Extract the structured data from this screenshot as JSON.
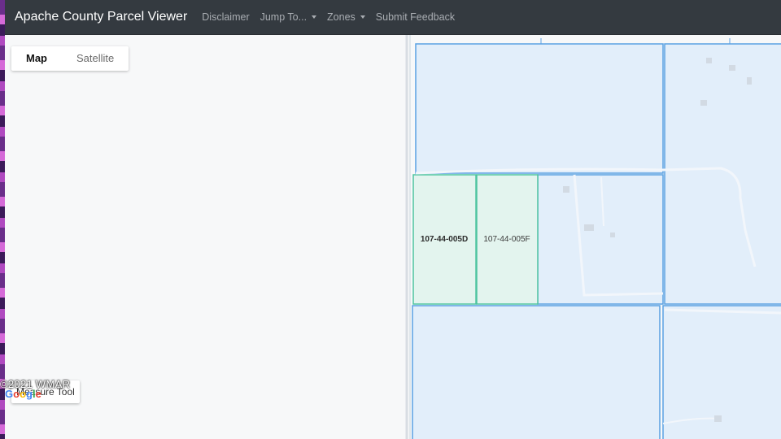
{
  "navbar": {
    "brand": "Apache County Parcel Viewer",
    "items": {
      "disclaimer": "Disclaimer",
      "jump_to": "Jump To...",
      "zones": "Zones",
      "feedback": "Submit Feedback"
    }
  },
  "map_type": {
    "map": "Map",
    "satellite": "Satellite"
  },
  "measure_tool": "Measure Tool",
  "watermark": "©2021 WMAR",
  "parcels": {
    "label_1": "107-44-005D",
    "label_2": "107-44-005F"
  },
  "colors": {
    "navbar_bg": "#343a40",
    "parcel_fill": "#e2eefa",
    "parcel_border": "#5aa1e3",
    "selected_fill": "#e3f4ee",
    "selected_border": "#4fc4a0"
  }
}
